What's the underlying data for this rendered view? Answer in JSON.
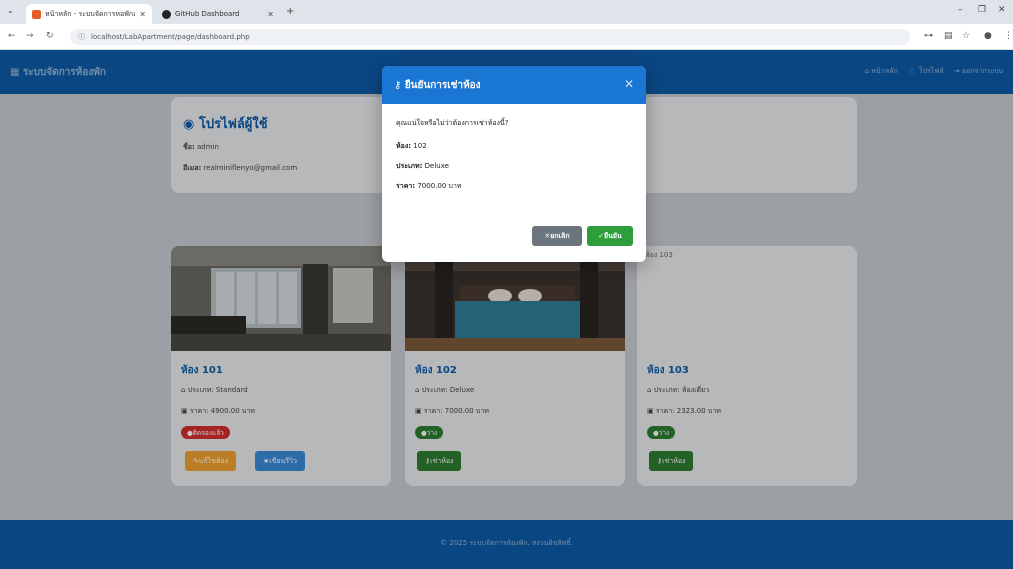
{
  "browser": {
    "tabs": [
      {
        "title": "หน้าหลัก - ระบบจัดการหอพักออนไลน์",
        "favicon_color": "#e35d2b"
      },
      {
        "title": "GitHub Dashboard",
        "favicon_color": "#222222"
      }
    ],
    "url": "localhost/LabApartment/page/dashboard.php"
  },
  "navbar": {
    "brand": "ระบบจัดการห้องพัก",
    "links": [
      {
        "icon": "home-icon",
        "label": "หน้าหลัก"
      },
      {
        "icon": "user-icon",
        "label": "โปรไฟล์"
      },
      {
        "icon": "logout-icon",
        "label": "ออกจากระบบ"
      }
    ]
  },
  "profile": {
    "title": "โปรไฟล์ผู้ใช้",
    "name_label": "ชื่อ:",
    "name": "admin",
    "email_label": "อีเมล:",
    "email": "realminiflenyo@gmail.com"
  },
  "rooms": [
    {
      "name": "ห้อง 101",
      "type_label": "ประเภท:",
      "type": "Standard",
      "price_label": "ราคา:",
      "price": "4900.00 บาท",
      "status": "ติดจองแล้ว",
      "status_color": "#d32f2f",
      "has_photo": true,
      "photo": "dark",
      "buttons": [
        {
          "label": "แก้ไขห้อง",
          "color": "#f0a030",
          "icon": "edit-icon"
        },
        {
          "label": "เขียนรีวิว",
          "color": "#3b8ad9",
          "icon": "star-icon"
        }
      ]
    },
    {
      "name": "ห้อง 102",
      "type_label": "ประเภท:",
      "type": "Deluxe",
      "price_label": "ราคา:",
      "price": "7000.00 บาท",
      "status": "ว่าง",
      "status_color": "#2e7d32",
      "has_photo": true,
      "photo": "bed",
      "buttons": [
        {
          "label": "เช่าห้อง",
          "color": "#2e7d32",
          "icon": "key-icon"
        }
      ]
    },
    {
      "name": "ห้อง 103",
      "type_label": "ประเภท:",
      "type": "ห้องเดี่ยว",
      "price_label": "ราคา:",
      "price": "2323.00 บาท",
      "status": "ว่าง",
      "status_color": "#2e7d32",
      "has_photo": false,
      "alt": "ห้อง 103",
      "buttons": [
        {
          "label": "เช่าห้อง",
          "color": "#2e7d32",
          "icon": "key-icon"
        }
      ]
    }
  ],
  "modal": {
    "title": "ยืนยันการเช่าห้อง",
    "question": "คุณแน่ใจหรือไม่ว่าต้องการเช่าห้องนี้?",
    "room_label": "ห้อง:",
    "room": "102",
    "type_label": "ประเภท:",
    "type": "Deluxe",
    "price_label": "ราคา:",
    "price": "7000.00 บาท",
    "cancel_label": "ยกเลิก",
    "confirm_label": "ยืนยัน",
    "header_color": "#1976d2"
  },
  "footer": {
    "text": "© 2025 ระบบจัดการห้องพัก. สงวนลิขสิทธิ์."
  }
}
